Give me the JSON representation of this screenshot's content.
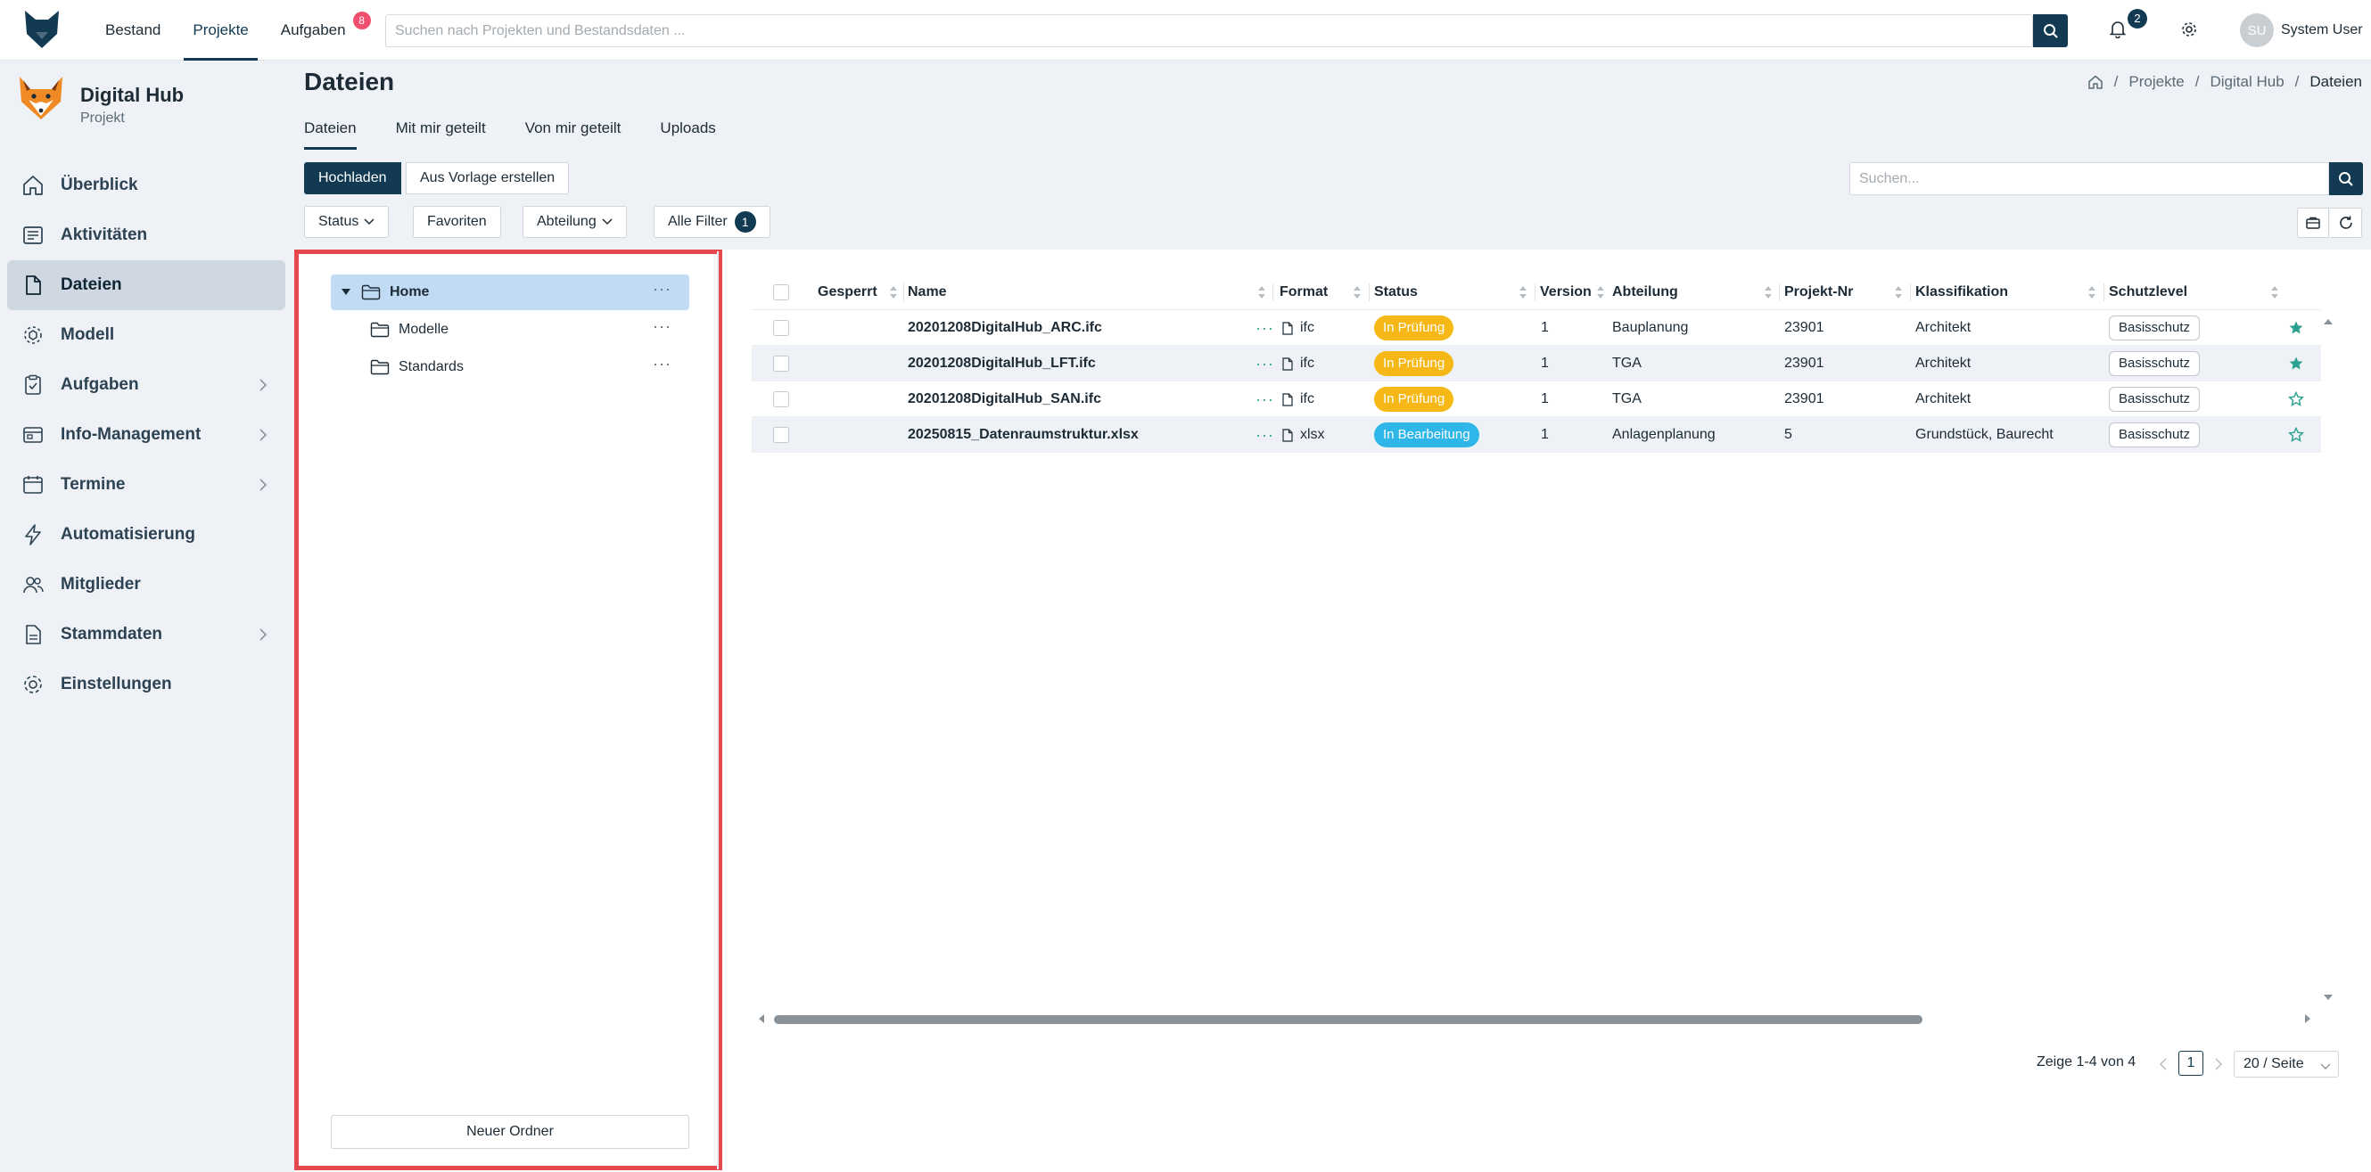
{
  "topbar": {
    "nav": [
      {
        "label": "Bestand"
      },
      {
        "label": "Projekte"
      },
      {
        "label": "Aufgaben",
        "badge": "8"
      }
    ],
    "search_placeholder": "Suchen nach Projekten und Bestandsdaten ...",
    "notifications_count": "2",
    "user": {
      "initials": "SU",
      "name": "System User"
    }
  },
  "sidebar": {
    "project_title": "Digital Hub",
    "project_subtitle": "Projekt",
    "items": [
      {
        "label": "Überblick",
        "icon": "home-icon"
      },
      {
        "label": "Aktivitäten",
        "icon": "activity-icon"
      },
      {
        "label": "Dateien",
        "icon": "file-icon"
      },
      {
        "label": "Modell",
        "icon": "model-icon"
      },
      {
        "label": "Aufgaben",
        "icon": "tasks-icon"
      },
      {
        "label": "Info-Management",
        "icon": "info-management-icon"
      },
      {
        "label": "Termine",
        "icon": "calendar-icon"
      },
      {
        "label": "Automatisierung",
        "icon": "lightning-icon"
      },
      {
        "label": "Mitglieder",
        "icon": "members-icon"
      },
      {
        "label": "Stammdaten",
        "icon": "master-data-icon"
      },
      {
        "label": "Einstellungen",
        "icon": "settings-icon"
      }
    ]
  },
  "page": {
    "title": "Dateien",
    "breadcrumb": [
      "Projekte",
      "Digital Hub",
      "Dateien"
    ],
    "tabs": [
      "Dateien",
      "Mit mir geteilt",
      "Von mir geteilt",
      "Uploads"
    ],
    "upload_label": "Hochladen",
    "template_label": "Aus Vorlage erstellen",
    "search_placeholder": "Suchen...",
    "filters": {
      "status": "Status",
      "favorites": "Favoriten",
      "department": "Abteilung",
      "all_filters": "Alle Filter",
      "all_filters_count": "1"
    }
  },
  "tree": {
    "root": "Home",
    "children": [
      "Modelle",
      "Standards"
    ],
    "new_folder_label": "Neuer Ordner"
  },
  "table": {
    "columns": {
      "locked": "Gesperrt",
      "name": "Name",
      "format": "Format",
      "status": "Status",
      "version": "Version",
      "department": "Abteilung",
      "project_nr": "Projekt-Nr",
      "classification": "Klassifikation",
      "protection": "Schutzlevel"
    },
    "rows": [
      {
        "name": "20201208DigitalHub_ARC.ifc",
        "format": "ifc",
        "status": "In Prüfung",
        "version": "1",
        "department": "Bauplanung",
        "project_nr": "23901",
        "classification": "Architekt",
        "protection": "Basisschutz"
      },
      {
        "name": "20201208DigitalHub_LFT.ifc",
        "format": "ifc",
        "status": "In Prüfung",
        "version": "1",
        "department": "TGA",
        "project_nr": "23901",
        "classification": "Architekt",
        "protection": "Basisschutz"
      },
      {
        "name": "20201208DigitalHub_SAN.ifc",
        "format": "ifc",
        "status": "In Prüfung",
        "version": "1",
        "department": "TGA",
        "project_nr": "23901",
        "classification": "Architekt",
        "protection": "Basisschutz"
      },
      {
        "name": "20250815_Datenraumstruktur.xlsx",
        "format": "xlsx",
        "status": "In Bearbeitung",
        "version": "1",
        "department": "Anlagenplanung",
        "project_nr": "5",
        "classification": "Grundstück, Baurecht",
        "protection": "Basisschutz"
      }
    ],
    "favorites": [
      true,
      true,
      false,
      false
    ]
  },
  "pagination": {
    "info": "Zeige 1-4 von 4",
    "current_page": "1",
    "page_size": "20 / Seite"
  },
  "colors": {
    "primary": "#123a52",
    "status_review": "#f5b816",
    "status_editing": "#2eb6e8",
    "favorite": "#2aa090",
    "highlight_border": "#e5484d"
  }
}
